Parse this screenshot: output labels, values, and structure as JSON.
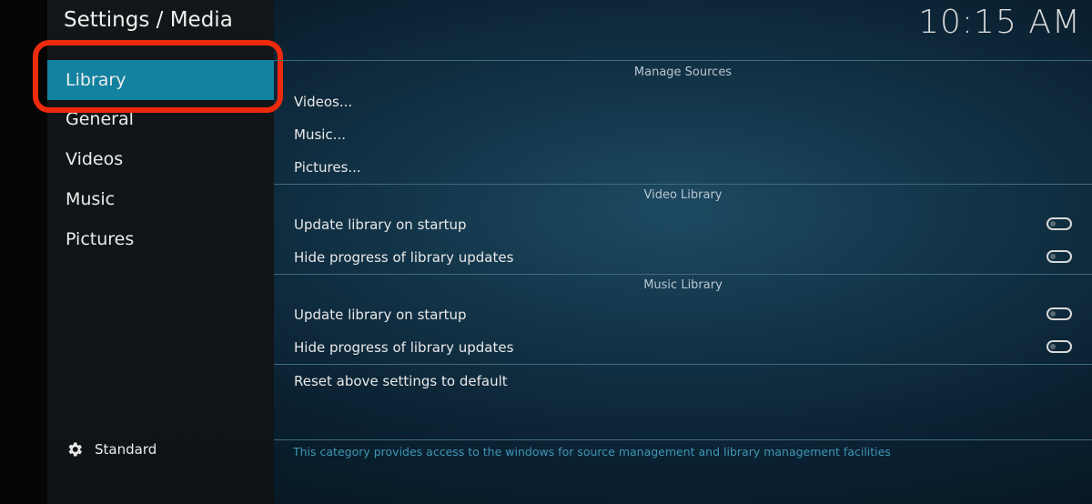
{
  "header": {
    "title": "Settings / Media",
    "clock": "10:15 AM"
  },
  "sidebar": {
    "items": [
      {
        "label": "Library"
      },
      {
        "label": "General"
      },
      {
        "label": "Videos"
      },
      {
        "label": "Music"
      },
      {
        "label": "Pictures"
      }
    ],
    "settings_level": "Standard"
  },
  "main": {
    "manage_sources": {
      "heading": "Manage Sources",
      "items": [
        "Videos...",
        "Music...",
        "Pictures..."
      ]
    },
    "video_library": {
      "heading": "Video Library",
      "items": [
        {
          "label": "Update library on startup",
          "enabled": false
        },
        {
          "label": "Hide progress of library updates",
          "enabled": false
        }
      ]
    },
    "music_library": {
      "heading": "Music Library",
      "items": [
        {
          "label": "Update library on startup",
          "enabled": false
        },
        {
          "label": "Hide progress of library updates",
          "enabled": false
        }
      ]
    },
    "reset_label": "Reset above settings to default",
    "description": "This category provides access to the windows for source management and library management facilities"
  },
  "colors": {
    "accent": "#11829f",
    "annotation": "#ee2a0d",
    "description_text": "#3f95b4"
  }
}
